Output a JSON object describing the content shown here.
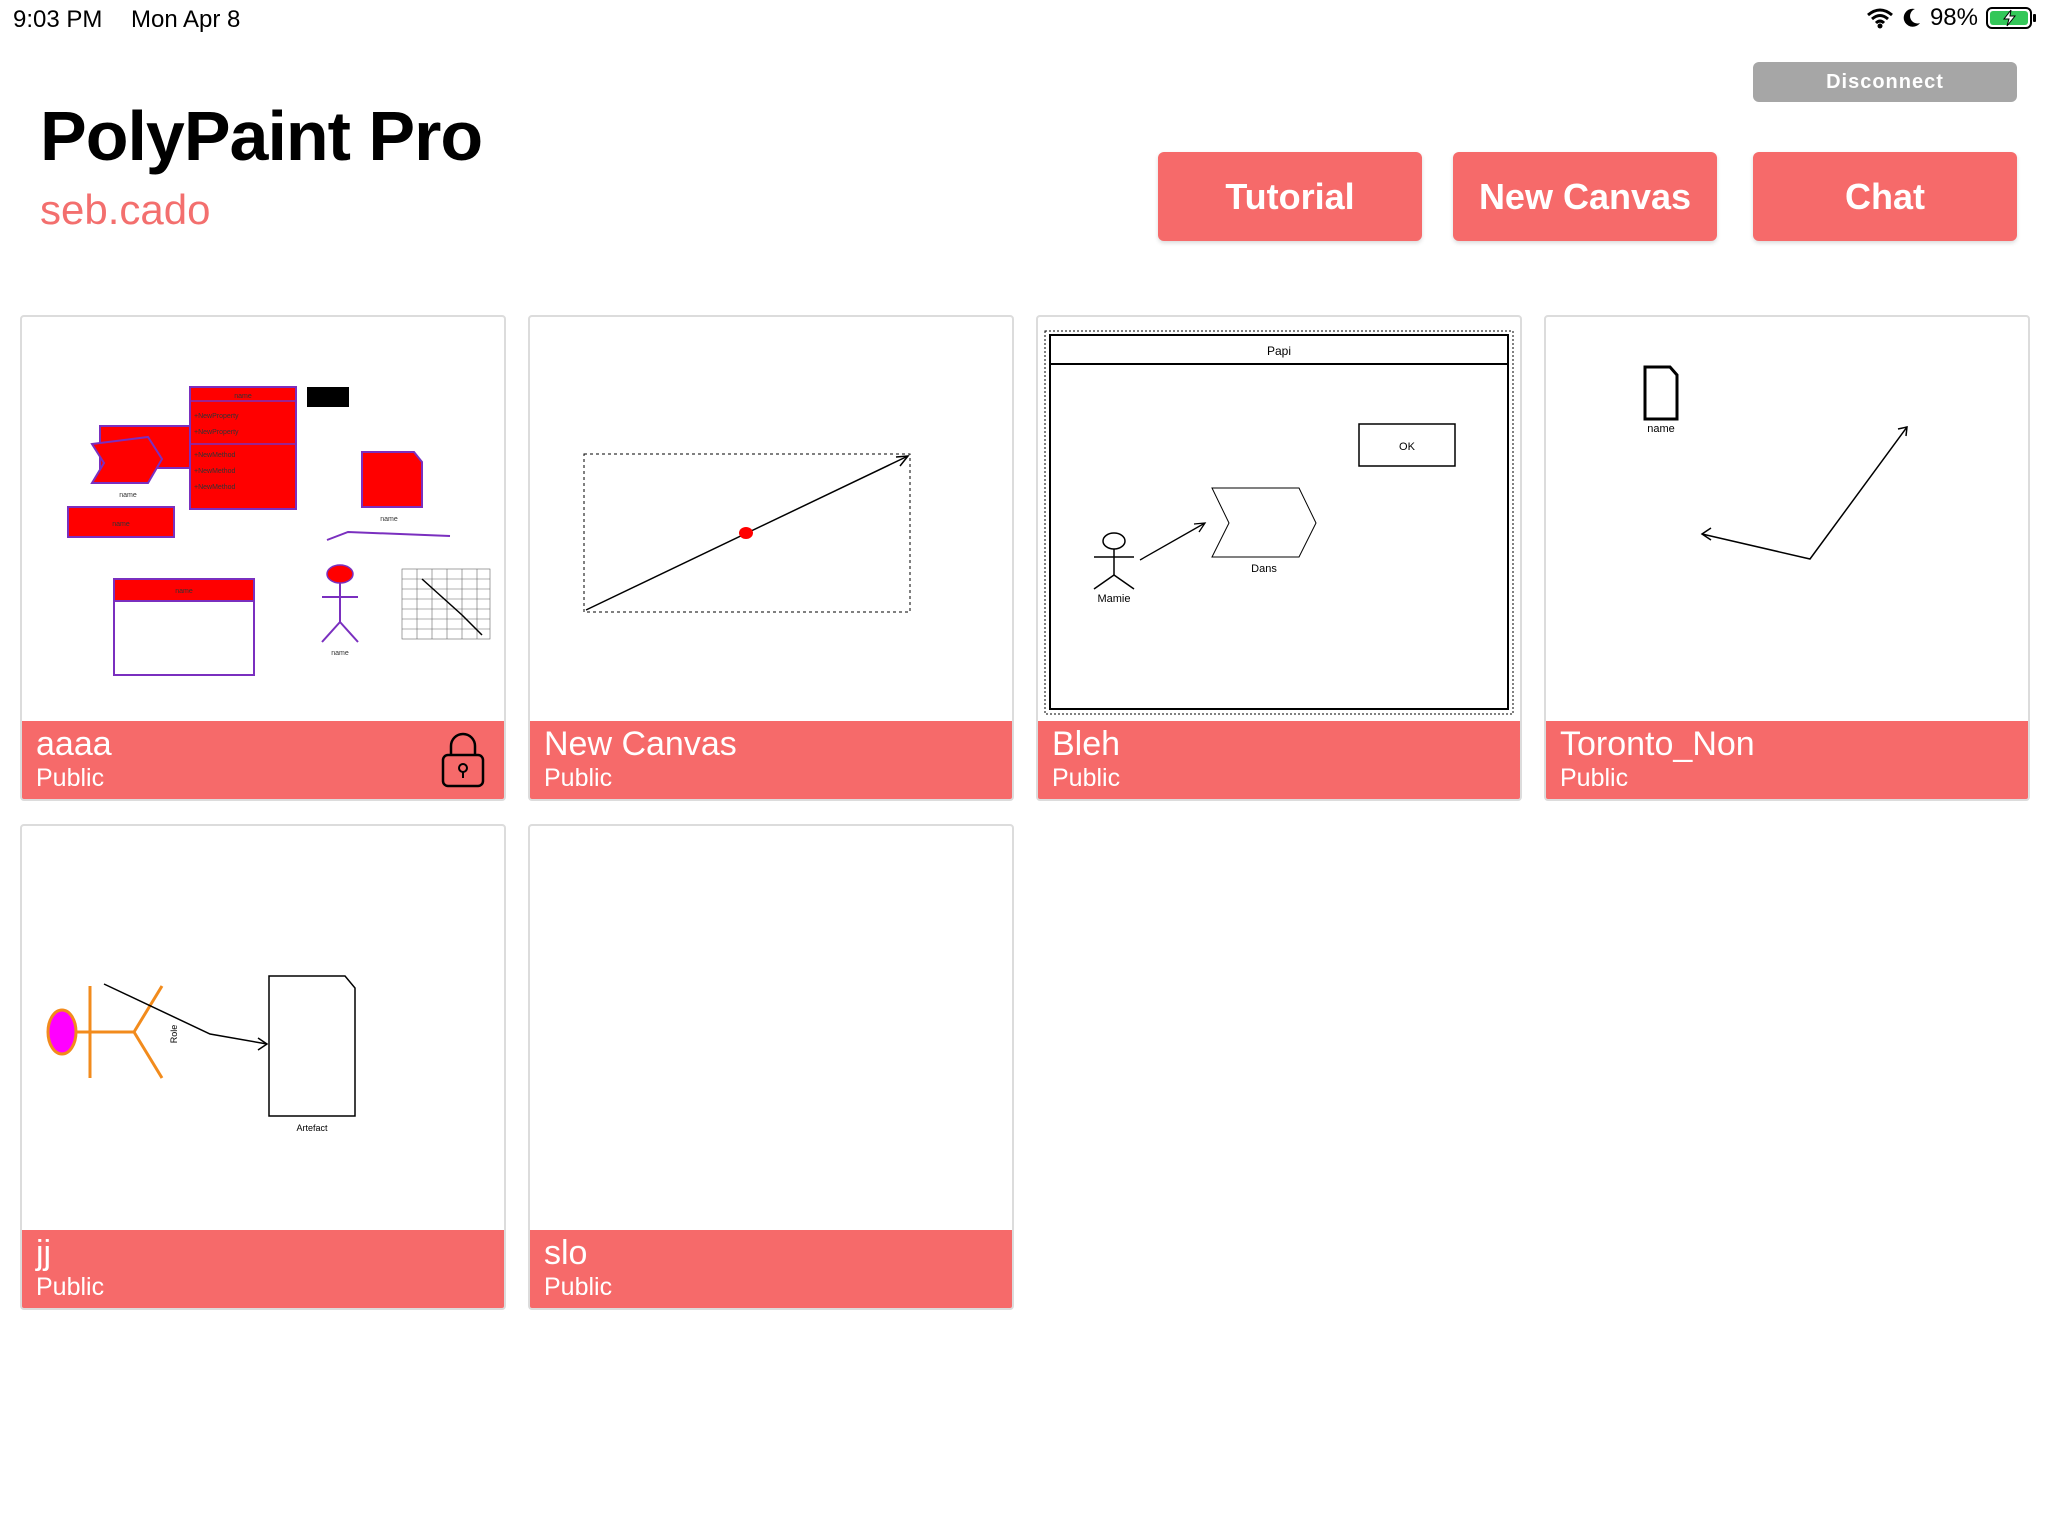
{
  "status_bar": {
    "time": "9:03 PM",
    "date": "Mon Apr 8",
    "battery": "98%"
  },
  "header": {
    "title": "PolyPaint Pro",
    "username": "seb.cado"
  },
  "buttons": {
    "disconnect": "Disconnect",
    "tutorial": "Tutorial",
    "new_canvas": "New Canvas",
    "chat": "Chat"
  },
  "colors": {
    "accent": "#f66a6a",
    "username": "#f36f6e",
    "disconnect": "#a6a6a6"
  },
  "canvases": [
    {
      "name": "aaaa",
      "visibility": "Public",
      "locked": true
    },
    {
      "name": "New Canvas",
      "visibility": "Public",
      "locked": false
    },
    {
      "name": "Bleh",
      "visibility": "Public",
      "locked": false
    },
    {
      "name": "Toronto_Non",
      "visibility": "Public",
      "locked": false
    },
    {
      "name": "jj",
      "visibility": "Public",
      "locked": false
    },
    {
      "name": "slo",
      "visibility": "Public",
      "locked": false
    }
  ],
  "thumb_labels": {
    "aaaa": {
      "class_title": "name",
      "prop1": "+NewProperty",
      "prop2": "+NewProperty",
      "m1": "+NewMethod",
      "m2": "+NewMethod",
      "m3": "+NewMethod",
      "actor_a": "name",
      "doc": "name",
      "box": "name",
      "box2": "name",
      "actor_b": "name"
    },
    "bleh": {
      "title": "Papi",
      "ok": "OK",
      "actor": "Mamie",
      "shape": "Dans"
    },
    "toronto": {
      "doc": "name"
    },
    "jj": {
      "role": "Role",
      "artefact": "Artefact"
    }
  }
}
